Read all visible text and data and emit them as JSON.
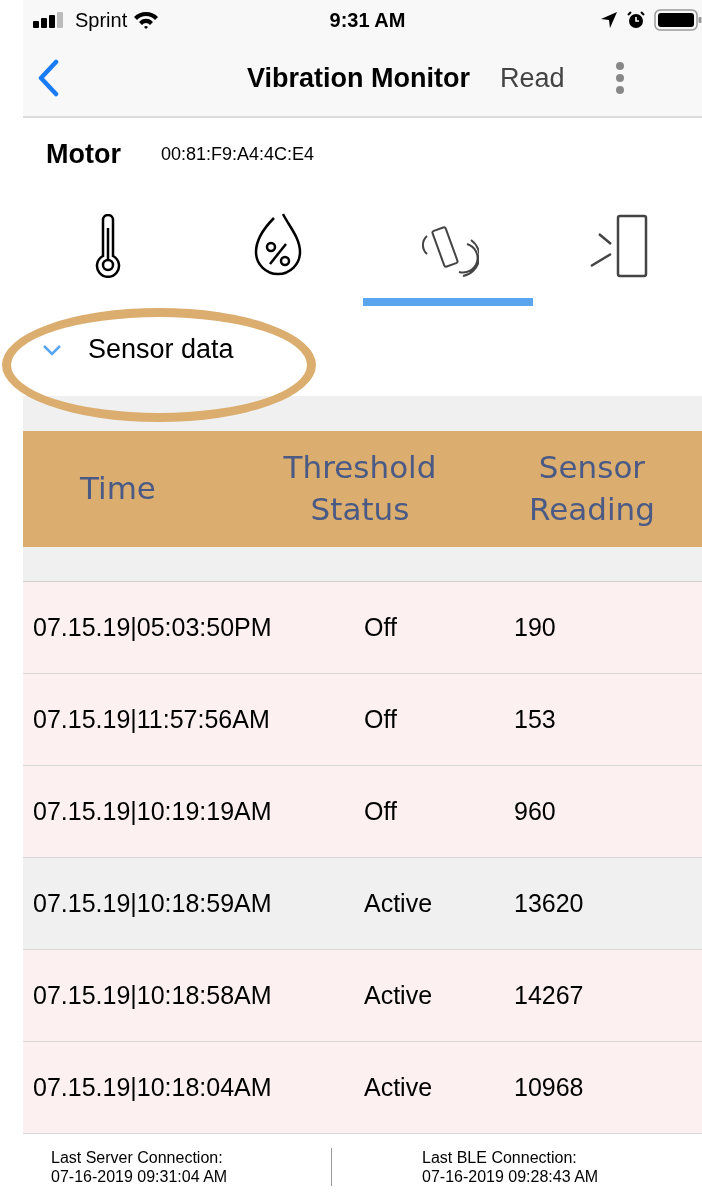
{
  "status_bar": {
    "carrier": "Sprint",
    "time": "9:31 AM"
  },
  "nav": {
    "title": "Vibration Monitor",
    "action": "Read"
  },
  "device": {
    "name": "Motor",
    "address": "00:81:F9:A4:4C:E4"
  },
  "tabs": [
    {
      "kind": "temperature",
      "selected": false
    },
    {
      "kind": "humidity",
      "selected": false
    },
    {
      "kind": "vibration",
      "selected": true
    },
    {
      "kind": "door",
      "selected": false
    }
  ],
  "section": {
    "title": "Sensor data",
    "expanded": true
  },
  "table": {
    "columns": [
      "Time",
      "Threshold Status",
      "Sensor Reading"
    ],
    "rows": [
      {
        "time": "07.15.19|05:03:50PM",
        "status": "Off",
        "reading": "190",
        "color": "#fdf0f0"
      },
      {
        "time": "07.15.19|11:57:56AM",
        "status": "Off",
        "reading": "153",
        "color": "#fdf0f0"
      },
      {
        "time": "07.15.19|10:19:19AM",
        "status": "Off",
        "reading": "960",
        "color": "#fdf0f0"
      },
      {
        "time": "07.15.19|10:18:59AM",
        "status": "Active",
        "reading": "13620",
        "color": "#f0f0f0"
      },
      {
        "time": "07.15.19|10:18:58AM",
        "status": "Active",
        "reading": "14267",
        "color": "#fdf0f0"
      },
      {
        "time": "07.15.19|10:18:04AM",
        "status": "Active",
        "reading": "10968",
        "color": "#fdf0f0"
      }
    ]
  },
  "footer": [
    {
      "label": "Last Server Connection:",
      "value": "07-16-2019 09:31:04 AM"
    },
    {
      "label": "Last BLE Connection:",
      "value": "07-16-2019 09:28:43 AM"
    }
  ]
}
